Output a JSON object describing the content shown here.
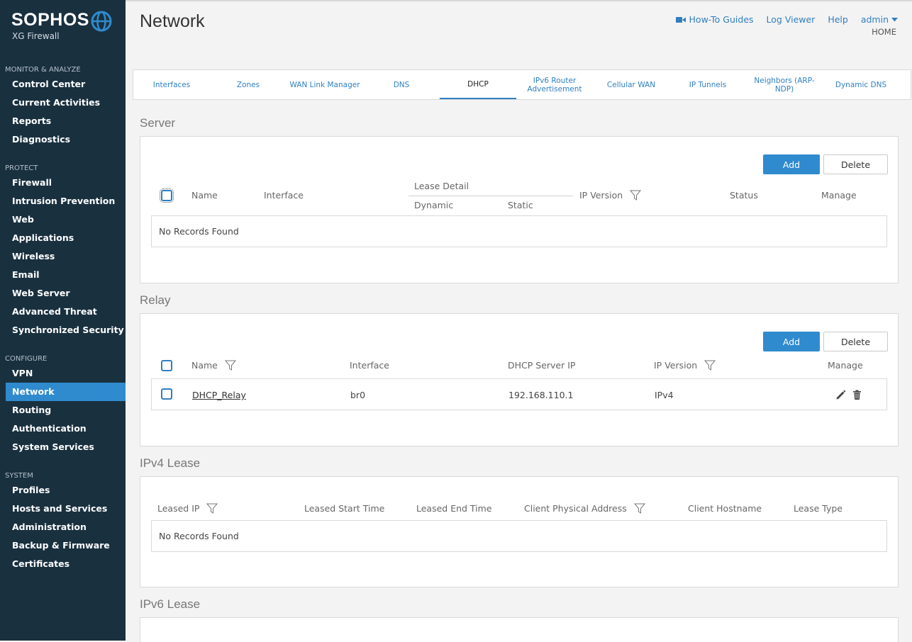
{
  "brand": {
    "name": "SOPHOS",
    "product": "XG Firewall"
  },
  "colors": {
    "sidebar": "#19303f",
    "accent": "#2f8bce",
    "link": "#2f7fc1"
  },
  "nav": [
    {
      "heading": "MONITOR & ANALYZE",
      "items": [
        "Control Center",
        "Current Activities",
        "Reports",
        "Diagnostics"
      ]
    },
    {
      "heading": "PROTECT",
      "items": [
        "Firewall",
        "Intrusion Prevention",
        "Web",
        "Applications",
        "Wireless",
        "Email",
        "Web Server",
        "Advanced Threat",
        "Synchronized Security"
      ]
    },
    {
      "heading": "CONFIGURE",
      "items": [
        "VPN",
        "Network",
        "Routing",
        "Authentication",
        "System Services"
      ],
      "active": "Network"
    },
    {
      "heading": "SYSTEM",
      "items": [
        "Profiles",
        "Hosts and Services",
        "Administration",
        "Backup & Firmware",
        "Certificates"
      ]
    }
  ],
  "header": {
    "title": "Network",
    "links": {
      "guides": "How-To Guides",
      "log_viewer": "Log Viewer",
      "help": "Help",
      "user": "admin"
    },
    "home": "HOME",
    "icons": {
      "guides": "video-camera-icon",
      "user_menu": "caret-down-icon"
    }
  },
  "tabs": [
    {
      "label": "Interfaces"
    },
    {
      "label": "Zones"
    },
    {
      "label": "WAN Link Manager"
    },
    {
      "label": "DNS"
    },
    {
      "label": "DHCP",
      "active": true
    },
    {
      "label": "IPv6 Router Advertisement"
    },
    {
      "label": "Cellular WAN"
    },
    {
      "label": "IP Tunnels"
    },
    {
      "label": "Neighbors (ARP-NDP)"
    },
    {
      "label": "Dynamic DNS"
    }
  ],
  "server": {
    "title": "Server",
    "add": "Add",
    "delete": "Delete",
    "columns": {
      "name": "Name",
      "interface": "Interface",
      "lease_detail": "Lease Detail",
      "dynamic": "Dynamic",
      "static": "Static",
      "ip_version": "IP Version",
      "status": "Status",
      "manage": "Manage"
    },
    "empty": "No Records Found"
  },
  "relay": {
    "title": "Relay",
    "add": "Add",
    "delete": "Delete",
    "columns": {
      "name": "Name",
      "interface": "Interface",
      "dhcp_server_ip": "DHCP Server IP",
      "ip_version": "IP Version",
      "manage": "Manage"
    },
    "rows": [
      {
        "name": "DHCP_Relay",
        "interface": "br0",
        "dhcp_server_ip": "192.168.110.1",
        "ip_version": "IPv4"
      }
    ],
    "icons": {
      "edit": "pencil-icon",
      "delete": "trash-icon"
    }
  },
  "ipv4_lease": {
    "title": "IPv4 Lease",
    "columns": {
      "leased_ip": "Leased IP",
      "start": "Leased Start Time",
      "end": "Leased End Time",
      "mac": "Client Physical Address",
      "hostname": "Client Hostname",
      "type": "Lease Type"
    },
    "empty": "No Records Found"
  },
  "ipv6_lease": {
    "title": "IPv6 Lease"
  }
}
